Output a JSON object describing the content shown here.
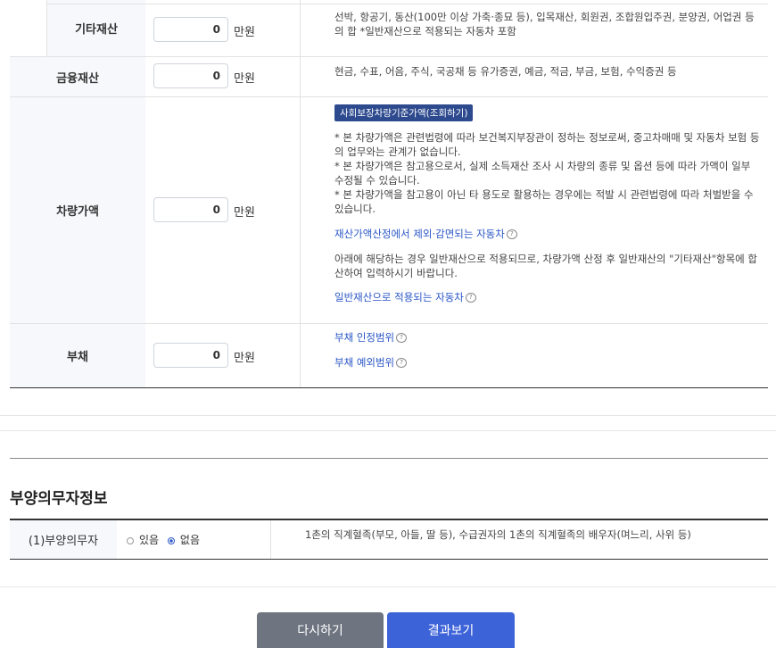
{
  "assets": {
    "other_property": {
      "label": "기타재산",
      "value": "0",
      "unit": "만원",
      "desc": "선박, 항공기, 동산(100만 이상 가축·종묘 등), 입목재산, 회원권, 조합원입주권, 분양권, 어업권 등의 합 *일반재산으로 적용되는 자동차 포함"
    },
    "financial": {
      "label": "금융재산",
      "value": "0",
      "unit": "만원",
      "desc": "현금, 수표, 어음, 주식, 국공채 등 유가증권, 예금, 적금, 부금, 보험, 수익증권 등"
    },
    "vehicle": {
      "label": "차량가액",
      "value": "0",
      "unit": "만원",
      "badge": "사회보장차량기준가액(조회하기)",
      "notes": [
        "* 본 차량가액은 관련법령에 따라 보건복지부장관이 정하는 정보로써, 중고차매매 및 자동차 보험 등의 업무와는 관계가 없습니다.",
        "* 본 차량가액은 참고용으로서, 실제 소득재산 조사 시 차량의 종류 및 옵션 등에 따라 가액이 일부 수정될 수 있습니다.",
        "* 본 차량가액을 참고용이 아닌 타 용도로 활용하는 경우에는 적발 시 관련법령에 따라 처벌받을 수 있습니다."
      ],
      "link_excluded": "재산가액산정에서 제외·감면되는 자동차",
      "general_note": "아래에 해당하는 경우 일반재산으로 적용되므로, 차량가액 산정 후 일반재산의 \"기타재산\"항목에 합산하여 입력하시기 바랍니다.",
      "link_general": "일반재산으로 적용되는 자동차"
    },
    "debt": {
      "label": "부채",
      "value": "0",
      "unit": "만원",
      "link_scope": "부채 인정범위",
      "link_exclusion": "부채 예외범위"
    }
  },
  "dependent": {
    "section_title": "부양의무자정보",
    "label": "(1)부양의무자",
    "option_yes": "있음",
    "option_no": "없음",
    "selected": "없음",
    "desc": "1촌의 직계혈족(부모, 아들, 딸 등), 수급권자의 1촌의 직계혈족의 배우자(며느리, 사위 등)"
  },
  "buttons": {
    "reset": "다시하기",
    "result": "결과보기"
  },
  "colors": {
    "link": "#2a56c6",
    "badge": "#2d4a8e",
    "reset_button": "#6e7480",
    "result_button": "#3d63d9"
  },
  "icons": {
    "help": "question-bubble-icon"
  }
}
